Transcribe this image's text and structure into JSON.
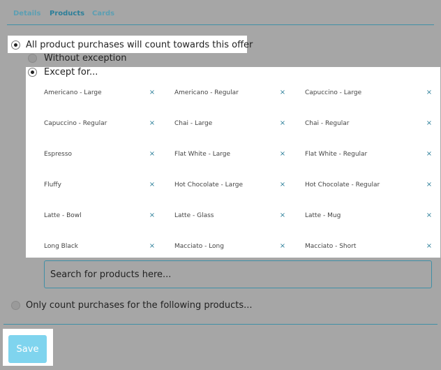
{
  "tabs": [
    {
      "label": "Details",
      "active": false
    },
    {
      "label": "Products",
      "active": true
    },
    {
      "label": "Cards",
      "active": false
    }
  ],
  "options": {
    "all": "All product purchases will count towards this offer",
    "without": "Without exception",
    "except": "Except for...",
    "only": "Only count purchases for the following products..."
  },
  "excluded_products": [
    "Americano - Large",
    "Americano - Regular",
    "Capuccino - Large",
    "Capuccino - Regular",
    "Chai - Large",
    "Chai - Regular",
    "Espresso",
    "Flat White - Large",
    "Flat White - Regular",
    "Fluffy",
    "Hot Chocolate - Large",
    "Hot Chocolate - Regular",
    "Latte - Bowl",
    "Latte - Glass",
    "Latte - Mug",
    "Long Black",
    "Macciato - Long",
    "Macciato - Short"
  ],
  "remove_glyph": "×",
  "search": {
    "placeholder": "Search for products here..."
  },
  "save_label": "Save",
  "colors": {
    "accent": "#3f8fa6",
    "save_button": "#7fd4ee",
    "overlay": "#a6a6a6"
  }
}
